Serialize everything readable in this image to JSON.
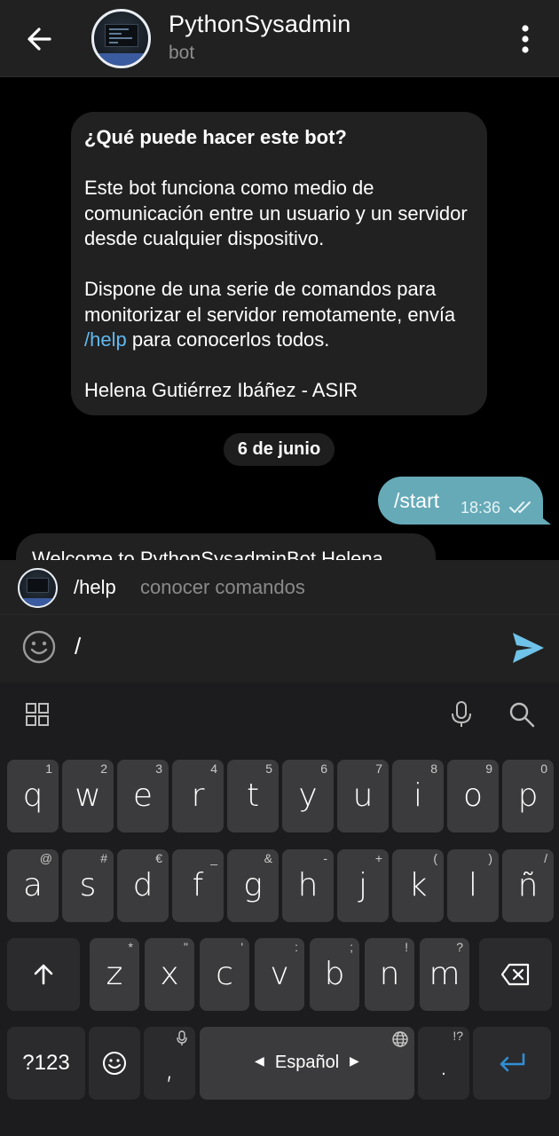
{
  "header": {
    "title": "PythonSysadmin",
    "subtitle": "bot"
  },
  "intro": {
    "heading": "¿Qué puede hacer este bot?",
    "para1": "Este bot funciona como medio de comunicación entre un usuario y un servidor desde cualquier dispositivo.",
    "para2_before": "Dispone de una serie de comandos para monitorizar el servidor remotamente, envía ",
    "para2_link": "/help",
    "para2_after": " para conocerlos todos.",
    "signature": "Helena Gutiérrez Ibáñez - ASIR"
  },
  "date_chip": "6 de junio",
  "outgoing": {
    "text": "/start",
    "time": "18:36"
  },
  "incoming_partial": "Welcome to PythonSysadminBot Helena",
  "suggestion": {
    "command": "/help",
    "description": "conocer comandos"
  },
  "input": {
    "value": "/"
  },
  "keyboard": {
    "row1": [
      {
        "k": "q",
        "s": "1"
      },
      {
        "k": "w",
        "s": "2"
      },
      {
        "k": "e",
        "s": "3"
      },
      {
        "k": "r",
        "s": "4"
      },
      {
        "k": "t",
        "s": "5"
      },
      {
        "k": "y",
        "s": "6"
      },
      {
        "k": "u",
        "s": "7"
      },
      {
        "k": "i",
        "s": "8"
      },
      {
        "k": "o",
        "s": "9"
      },
      {
        "k": "p",
        "s": "0"
      }
    ],
    "row2": [
      {
        "k": "a",
        "s": "@"
      },
      {
        "k": "s",
        "s": "#"
      },
      {
        "k": "d",
        "s": "€"
      },
      {
        "k": "f",
        "s": "_"
      },
      {
        "k": "g",
        "s": "&"
      },
      {
        "k": "h",
        "s": "-"
      },
      {
        "k": "j",
        "s": "+"
      },
      {
        "k": "k",
        "s": "("
      },
      {
        "k": "l",
        "s": ")"
      },
      {
        "k": "ñ",
        "s": "/"
      }
    ],
    "row3": [
      {
        "k": "z",
        "s": "*"
      },
      {
        "k": "x",
        "s": "\""
      },
      {
        "k": "c",
        "s": "'"
      },
      {
        "k": "v",
        "s": ":"
      },
      {
        "k": "b",
        "s": ";"
      },
      {
        "k": "n",
        "s": "!"
      },
      {
        "k": "m",
        "s": "?"
      }
    ],
    "symbols_label": "?123",
    "comma_label": ",",
    "space_label": "Español",
    "period_label": ".",
    "period_sup": "!?"
  },
  "colors": {
    "accent": "#62b8f0",
    "outgoing_bubble": "#66aab8",
    "send": "#6fc3e8"
  }
}
